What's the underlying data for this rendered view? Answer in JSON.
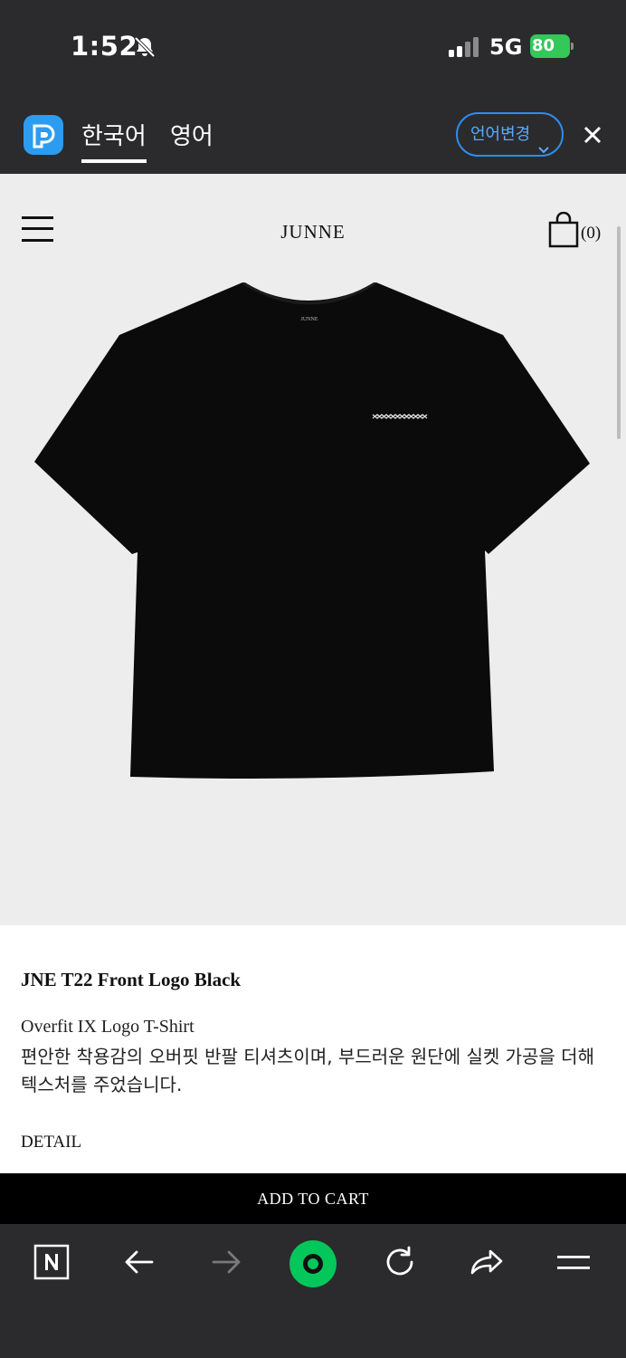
{
  "status_bar": {
    "time": "1:52",
    "network": "5G",
    "battery": "80"
  },
  "translate_bar": {
    "tab_korean": "한국어",
    "tab_english": "영어",
    "change_language_label": "언어변경"
  },
  "site_header": {
    "brand": "JUNNE",
    "cart_count": "(0)"
  },
  "product": {
    "title": "JNE T22 Front Logo Black",
    "subtitle": "Overfit IX Logo T-Shirt",
    "description": "편안한 착용감의 오버핏 반팔 티셔츠이며, 부드러운 원단에 실켓 가공을 더해 텍스처를 주었습니다.",
    "detail_label": "DETAIL",
    "neck_label": "JUNNE",
    "image_color": "#0b0b0b"
  },
  "add_to_cart_label": "ADD TO CART",
  "colors": {
    "chrome_bg": "#2b2b2d",
    "accent_blue": "#2c8ef0",
    "naver_green": "#03c75a",
    "battery_green": "#34c759"
  },
  "browser_toolbar": {
    "icons": [
      "naver-n-icon",
      "back-arrow-icon",
      "forward-arrow-icon",
      "home-green-icon",
      "refresh-icon",
      "share-icon",
      "menu-icon"
    ]
  }
}
